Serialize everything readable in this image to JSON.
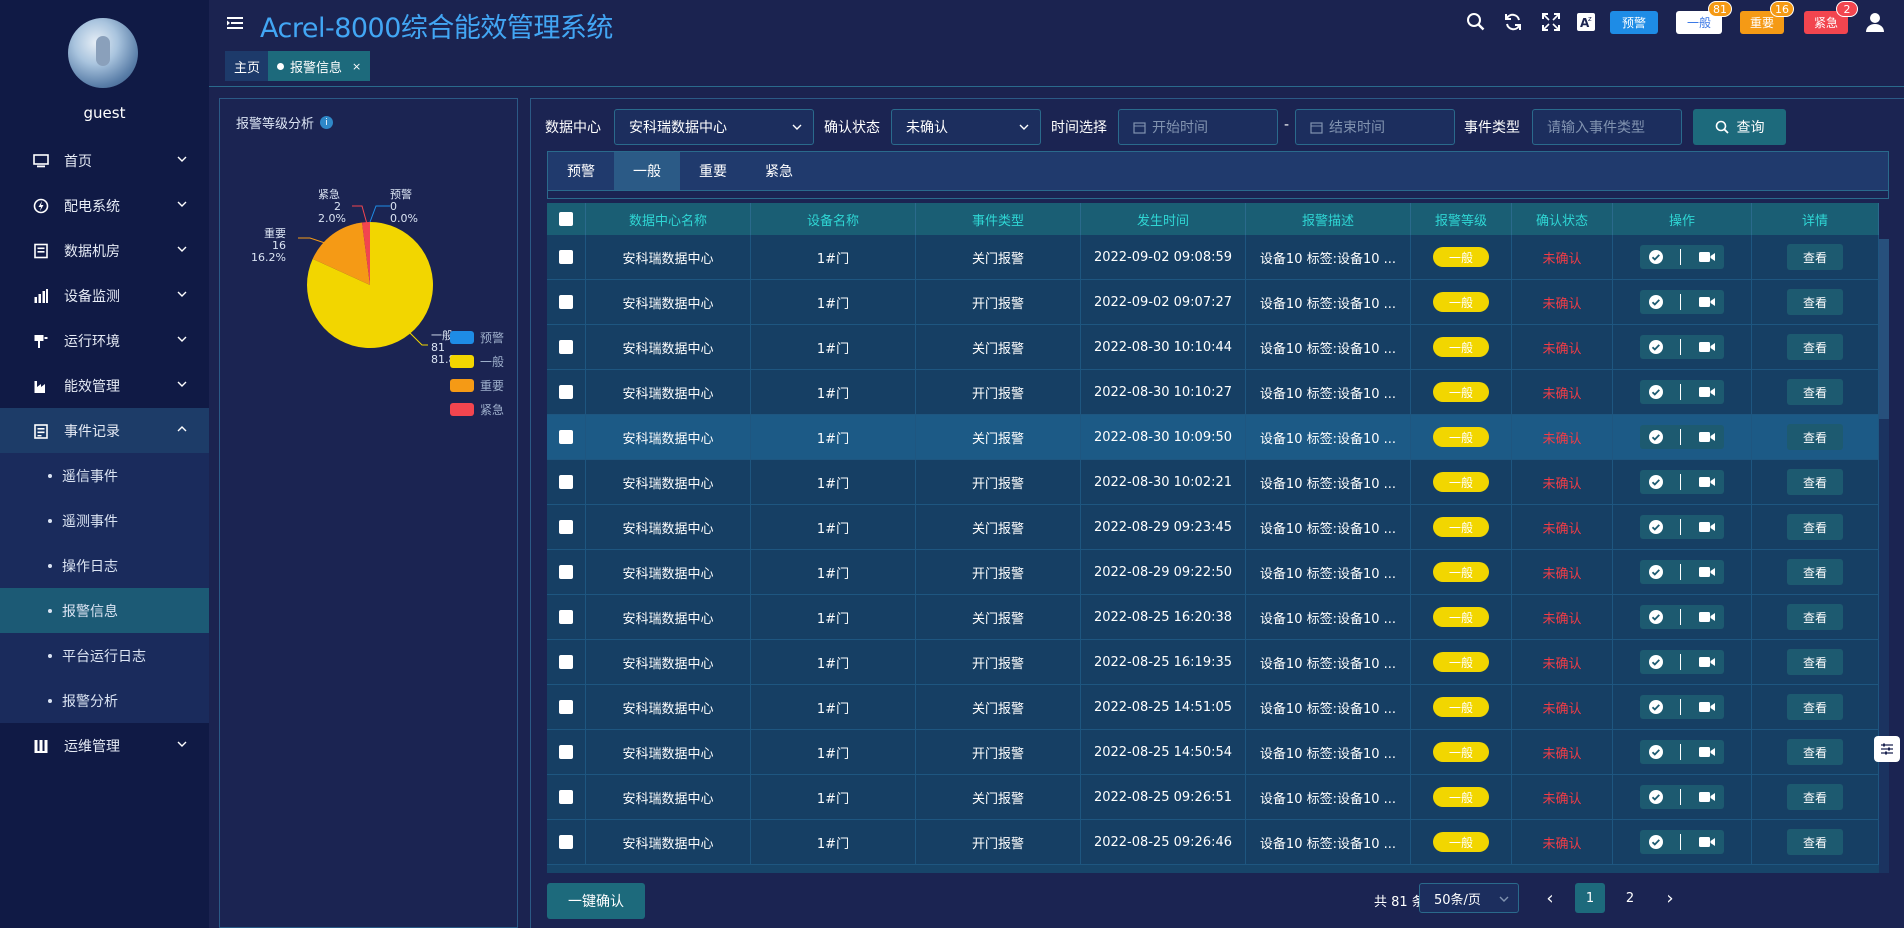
{
  "user": {
    "name": "guest"
  },
  "header": {
    "title": "Acrel-8000综合能效管理系统",
    "tags": [
      {
        "label": "预警",
        "count": "",
        "bg": "#1e8ce6",
        "fg": "#ffffff"
      },
      {
        "label": "一般",
        "count": "81",
        "bg": "#ffffff",
        "fg": "#3a78e6"
      },
      {
        "label": "重要",
        "count": "16",
        "bg": "#f59a15",
        "fg": "#ffffff"
      },
      {
        "label": "紧急",
        "count": "2",
        "bg": "#f2454f",
        "fg": "#ffffff"
      }
    ]
  },
  "tabbar": {
    "home": "主页",
    "current": "报警信息",
    "close": "×"
  },
  "sidebar": {
    "items": [
      {
        "label": "首页"
      },
      {
        "label": "配电系统"
      },
      {
        "label": "数据机房"
      },
      {
        "label": "设备监测"
      },
      {
        "label": "运行环境"
      },
      {
        "label": "能效管理"
      },
      {
        "label": "事件记录"
      },
      {
        "label": "运维管理"
      }
    ],
    "subitems": [
      {
        "label": "遥信事件"
      },
      {
        "label": "遥测事件"
      },
      {
        "label": "操作日志"
      },
      {
        "label": "报警信息"
      },
      {
        "label": "平台运行日志"
      },
      {
        "label": "报警分析"
      }
    ]
  },
  "analysis": {
    "title": "报警等级分析",
    "info": "i",
    "labels": {
      "emergency": {
        "name": "紧急",
        "count": "2",
        "pct": "2.0%"
      },
      "warning": {
        "name": "预警",
        "count": "0",
        "pct": "0.0%"
      },
      "important": {
        "name": "重要",
        "count": "16",
        "pct": "16.2%"
      },
      "general": {
        "name": "一般",
        "count": "81",
        "pct": "81.8%"
      }
    },
    "legend": [
      {
        "name": "预警",
        "color": "#1e8ce6"
      },
      {
        "name": "一般",
        "color": "#f2d600"
      },
      {
        "name": "重要",
        "color": "#f59a15"
      },
      {
        "name": "紧急",
        "color": "#f2454f"
      }
    ]
  },
  "chart_data": {
    "type": "pie",
    "categories": [
      "预警",
      "一般",
      "重要",
      "紧急"
    ],
    "values": [
      0,
      81,
      16,
      2
    ],
    "percents": [
      0.0,
      81.8,
      16.2,
      2.0
    ],
    "colors": [
      "#1e8ce6",
      "#f2d600",
      "#f59a15",
      "#f2454f"
    ],
    "title": "报警等级分析"
  },
  "filters": {
    "datacenter_label": "数据中心",
    "datacenter_value": "安科瑞数据中心",
    "confirm_label": "确认状态",
    "confirm_value": "未确认",
    "time_label": "时间选择",
    "start_placeholder": "开始时间",
    "dash": "-",
    "end_placeholder": "结束时间",
    "event_type_label": "事件类型",
    "event_type_placeholder": "请输入事件类型",
    "query_label": "查询"
  },
  "level_tabs": [
    "预警",
    "一般",
    "重要",
    "紧急"
  ],
  "table": {
    "columns": [
      "数据中心名称",
      "设备名称",
      "事件类型",
      "发生时间",
      "报警描述",
      "报警等级",
      "确认状态",
      "操作",
      "详情"
    ],
    "rows": [
      {
        "dc": "安科瑞数据中心",
        "device": "1#门",
        "type": "关门报警",
        "time": "2022-09-02 09:08:59",
        "desc": "设备10 标签:设备10 ...",
        "level": "一般",
        "status": "未确认",
        "detail": "查看"
      },
      {
        "dc": "安科瑞数据中心",
        "device": "1#门",
        "type": "开门报警",
        "time": "2022-09-02 09:07:27",
        "desc": "设备10 标签:设备10 ...",
        "level": "一般",
        "status": "未确认",
        "detail": "查看"
      },
      {
        "dc": "安科瑞数据中心",
        "device": "1#门",
        "type": "关门报警",
        "time": "2022-08-30 10:10:44",
        "desc": "设备10 标签:设备10 ...",
        "level": "一般",
        "status": "未确认",
        "detail": "查看"
      },
      {
        "dc": "安科瑞数据中心",
        "device": "1#门",
        "type": "开门报警",
        "time": "2022-08-30 10:10:27",
        "desc": "设备10 标签:设备10 ...",
        "level": "一般",
        "status": "未确认",
        "detail": "查看"
      },
      {
        "dc": "安科瑞数据中心",
        "device": "1#门",
        "type": "关门报警",
        "time": "2022-08-30 10:09:50",
        "desc": "设备10 标签:设备10 ...",
        "level": "一般",
        "status": "未确认",
        "detail": "查看"
      },
      {
        "dc": "安科瑞数据中心",
        "device": "1#门",
        "type": "开门报警",
        "time": "2022-08-30 10:02:21",
        "desc": "设备10 标签:设备10 ...",
        "level": "一般",
        "status": "未确认",
        "detail": "查看"
      },
      {
        "dc": "安科瑞数据中心",
        "device": "1#门",
        "type": "关门报警",
        "time": "2022-08-29 09:23:45",
        "desc": "设备10 标签:设备10 ...",
        "level": "一般",
        "status": "未确认",
        "detail": "查看"
      },
      {
        "dc": "安科瑞数据中心",
        "device": "1#门",
        "type": "开门报警",
        "time": "2022-08-29 09:22:50",
        "desc": "设备10 标签:设备10 ...",
        "level": "一般",
        "status": "未确认",
        "detail": "查看"
      },
      {
        "dc": "安科瑞数据中心",
        "device": "1#门",
        "type": "关门报警",
        "time": "2022-08-25 16:20:38",
        "desc": "设备10 标签:设备10 ...",
        "level": "一般",
        "status": "未确认",
        "detail": "查看"
      },
      {
        "dc": "安科瑞数据中心",
        "device": "1#门",
        "type": "开门报警",
        "time": "2022-08-25 16:19:35",
        "desc": "设备10 标签:设备10 ...",
        "level": "一般",
        "status": "未确认",
        "detail": "查看"
      },
      {
        "dc": "安科瑞数据中心",
        "device": "1#门",
        "type": "关门报警",
        "time": "2022-08-25 14:51:05",
        "desc": "设备10 标签:设备10 ...",
        "level": "一般",
        "status": "未确认",
        "detail": "查看"
      },
      {
        "dc": "安科瑞数据中心",
        "device": "1#门",
        "type": "开门报警",
        "time": "2022-08-25 14:50:54",
        "desc": "设备10 标签:设备10 ...",
        "level": "一般",
        "status": "未确认",
        "detail": "查看"
      },
      {
        "dc": "安科瑞数据中心",
        "device": "1#门",
        "type": "关门报警",
        "time": "2022-08-25 09:26:51",
        "desc": "设备10 标签:设备10 ...",
        "level": "一般",
        "status": "未确认",
        "detail": "查看"
      },
      {
        "dc": "安科瑞数据中心",
        "device": "1#门",
        "type": "开门报警",
        "time": "2022-08-25 09:26:46",
        "desc": "设备10 标签:设备10 ...",
        "level": "一般",
        "status": "未确认",
        "detail": "查看"
      }
    ]
  },
  "footer": {
    "confirm_all": "一键确认",
    "total": "共 81 条",
    "page_size": "50条/页",
    "pages": [
      "1",
      "2"
    ],
    "prev": "‹",
    "next": "›"
  }
}
